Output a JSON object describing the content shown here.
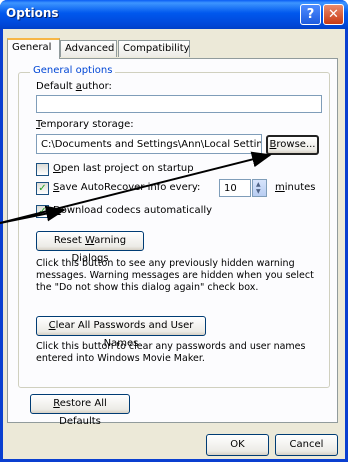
{
  "window": {
    "title": "Options",
    "help": "?",
    "close": "✕"
  },
  "tabs": [
    "General",
    "Advanced",
    "Compatibility"
  ],
  "group_title": "General options",
  "author": {
    "label_pre": "Default ",
    "label_key": "a",
    "label_post": "uthor:",
    "value": ""
  },
  "storage": {
    "label_pre": "",
    "label_key": "T",
    "label_post": "emporary storage:",
    "value": "C:\\Documents and Settings\\Ann\\Local Settings\\Te"
  },
  "browse": {
    "key": "B",
    "rest": "rowse..."
  },
  "open_last": {
    "key": "O",
    "rest": "pen last project on startup",
    "checked": false
  },
  "autorecover": {
    "key": "S",
    "rest": "ave AutoRecover info every:",
    "checked": true,
    "value": "10",
    "unit_key": "m",
    "unit_rest": "inutes"
  },
  "codecs": {
    "key": "D",
    "rest": "ownload codecs automatically",
    "checked": true
  },
  "reset": {
    "pre": "Reset ",
    "key": "W",
    "rest": "arning Dialogs"
  },
  "reset_desc": "Click this button to see any previously hidden warning messages. Warning messages are hidden when you select the \"Do not show this dialog again\" check box.",
  "clear": {
    "key": "C",
    "rest": "lear All Passwords and User Names"
  },
  "clear_desc": "Click this button to clear any passwords and user names entered into Windows Movie Maker.",
  "restore": {
    "key": "R",
    "rest": "estore All Defaults"
  },
  "ok": "OK",
  "cancel": "Cancel",
  "colors": {
    "title_blue": "#0058ee",
    "group_label": "#0046d5",
    "tab_highlight": "#f7b646",
    "arrow": "#000000"
  },
  "icons": {
    "check": "checkmark-icon",
    "spin_up": "up-arrow-icon",
    "spin_down": "down-arrow-icon"
  }
}
